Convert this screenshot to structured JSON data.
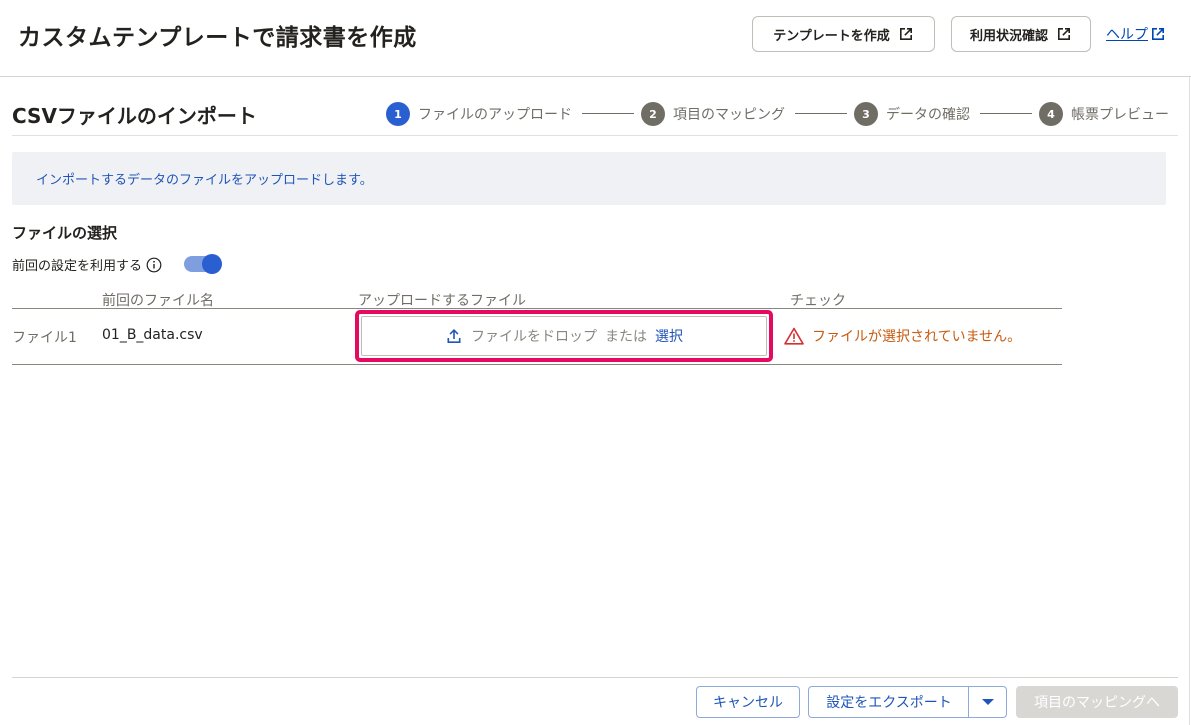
{
  "header": {
    "title": "カスタムテンプレートで請求書を作成",
    "create_template_label": "テンプレートを作成",
    "usage_label": "利用状況確認",
    "help_label": "ヘルプ"
  },
  "section": {
    "title": "CSVファイルのインポート"
  },
  "steps": [
    {
      "num": "1",
      "label": "ファイルのアップロード",
      "active": true
    },
    {
      "num": "2",
      "label": "項目のマッピング",
      "active": false
    },
    {
      "num": "3",
      "label": "データの確認",
      "active": false
    },
    {
      "num": "4",
      "label": "帳票プレビュー",
      "active": false
    }
  ],
  "info_message": "インポートするデータのファイルをアップロードします。",
  "file_select": {
    "title": "ファイルの選択",
    "reuse_label": "前回の設定を利用する",
    "reuse_enabled": true
  },
  "table": {
    "headers": [
      "前回のファイル名",
      "アップロードするファイル",
      "チェック"
    ],
    "rows": [
      {
        "label": "ファイル1",
        "previous_file": "01_B_data.csv",
        "drop_text": "ファイルをドロップ",
        "or_text": "または",
        "select_text": "選択",
        "check_message": "ファイルが選択されていません。"
      }
    ]
  },
  "footer": {
    "cancel_label": "キャンセル",
    "export_label": "設定をエクスポート",
    "next_label": "項目のマッピングへ"
  },
  "colors": {
    "accent": "#2a5fd1",
    "link": "#1f55b8",
    "warning": "#c75b10",
    "highlight": "#e5095f"
  }
}
